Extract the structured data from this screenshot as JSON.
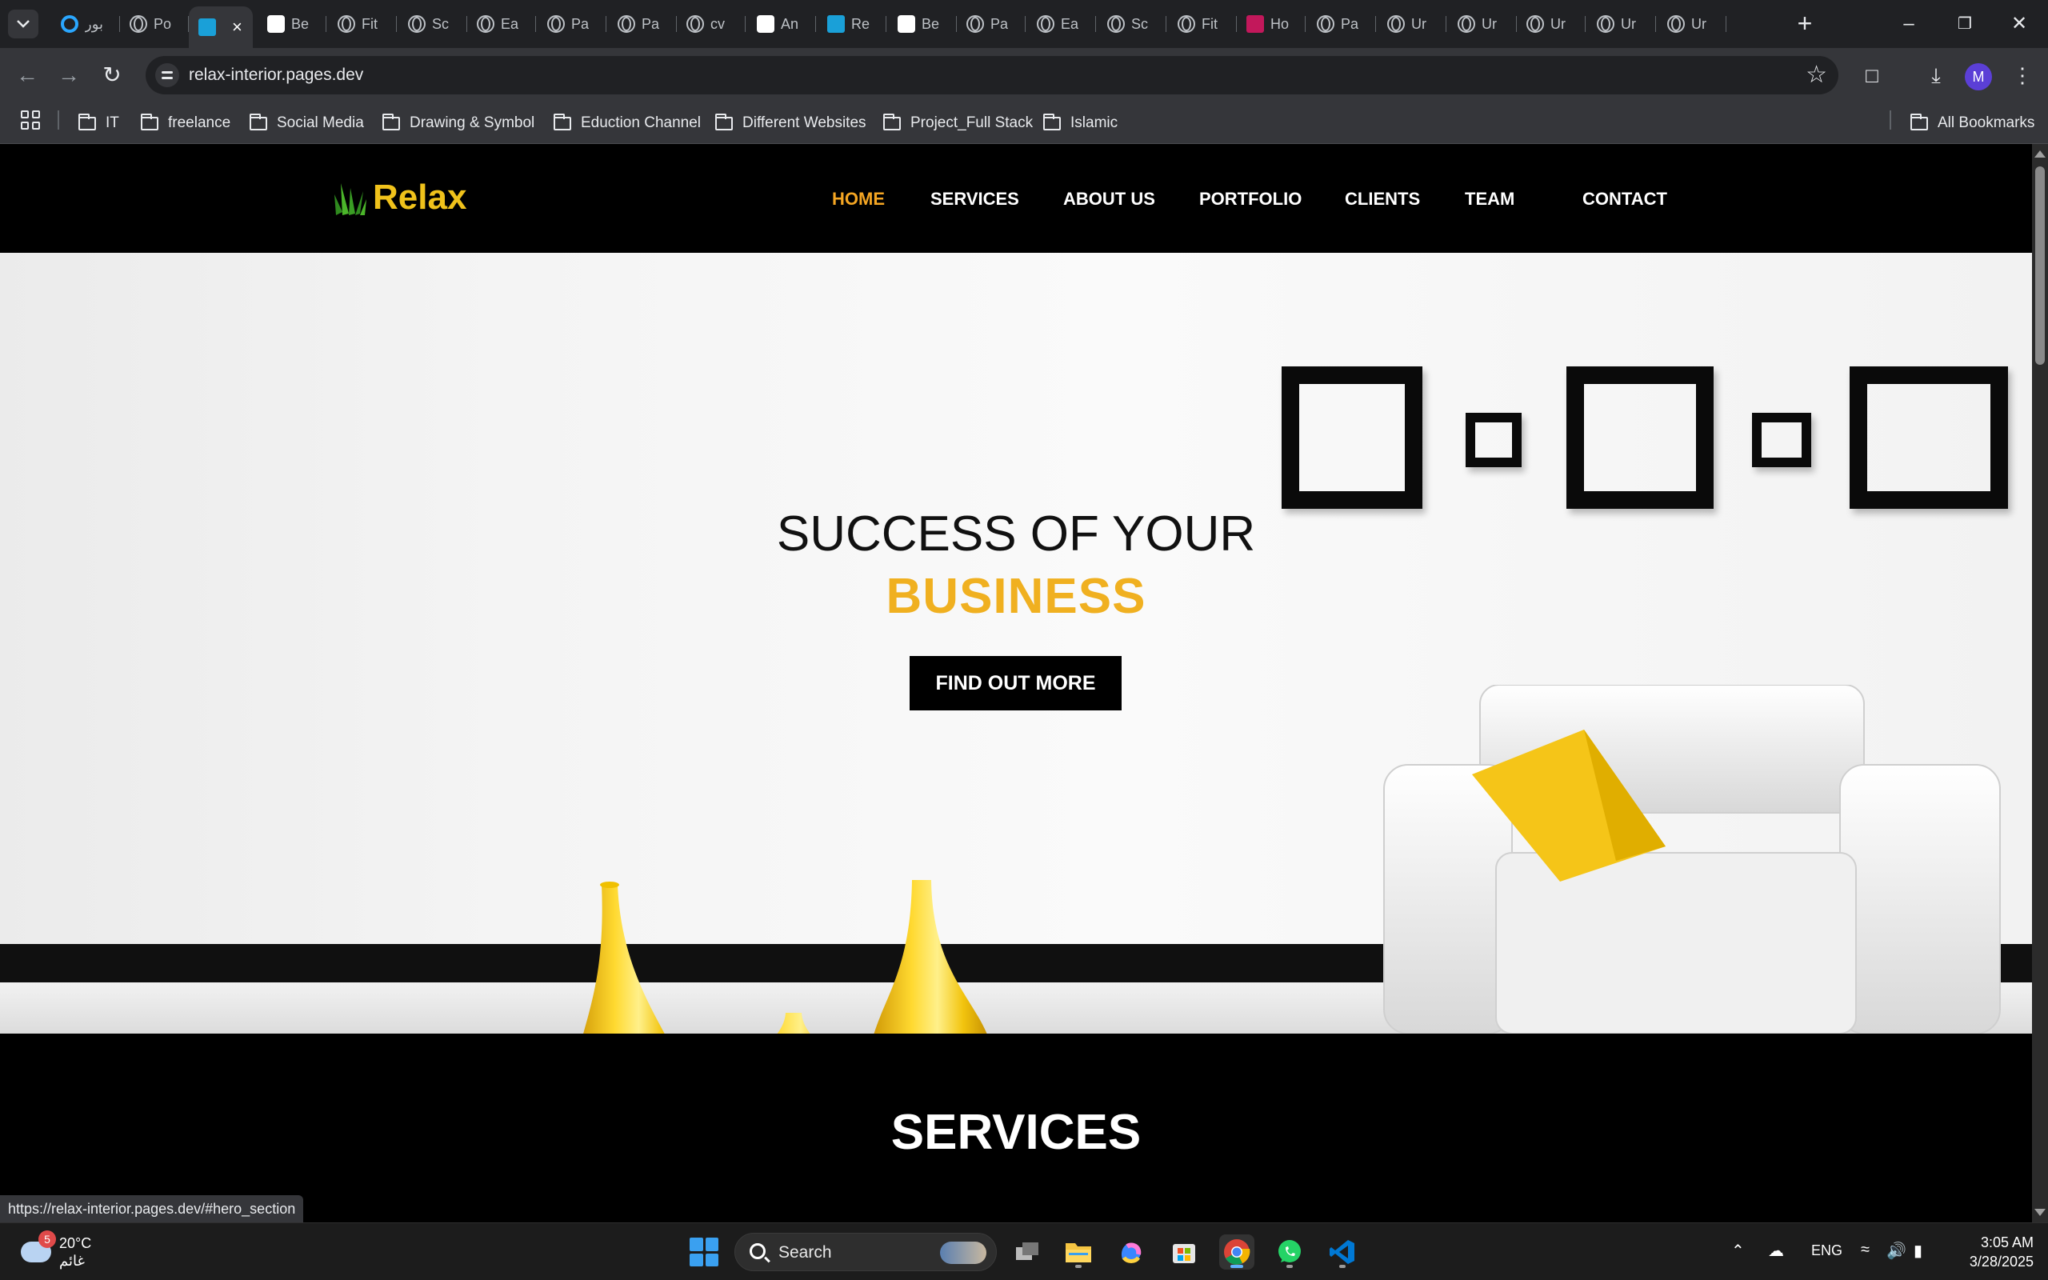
{
  "browser": {
    "tabs": [
      {
        "title": "بور",
        "icon": "cortana-icon",
        "active": false
      },
      {
        "title": "Po",
        "icon": "globe-icon",
        "active": false
      },
      {
        "title": "",
        "icon": "bing-icon",
        "active": true
      },
      {
        "title": "Be",
        "icon": "behance-icon",
        "active": false
      },
      {
        "title": "Fit",
        "icon": "globe-icon",
        "active": false
      },
      {
        "title": "Sc",
        "icon": "globe-icon",
        "active": false
      },
      {
        "title": "Ea",
        "icon": "globe-icon",
        "active": false
      },
      {
        "title": "Pa",
        "icon": "globe-icon",
        "active": false
      },
      {
        "title": "Pa",
        "icon": "globe-icon",
        "active": false
      },
      {
        "title": "cv",
        "icon": "globe-icon",
        "active": false
      },
      {
        "title": "An",
        "icon": "behance-icon",
        "active": false
      },
      {
        "title": "Re",
        "icon": "bing-icon",
        "active": false
      },
      {
        "title": "Be",
        "icon": "behance-icon",
        "active": false
      },
      {
        "title": "Pa",
        "icon": "globe-icon",
        "active": false
      },
      {
        "title": "Ea",
        "icon": "globe-icon",
        "active": false
      },
      {
        "title": "Sc",
        "icon": "globe-icon",
        "active": false
      },
      {
        "title": "Fit",
        "icon": "globe-icon",
        "active": false
      },
      {
        "title": "Ho",
        "icon": "angular-icon",
        "active": false
      },
      {
        "title": "Pa",
        "icon": "globe-icon",
        "active": false
      },
      {
        "title": "Ur",
        "icon": "globe-icon",
        "active": false
      },
      {
        "title": "Ur",
        "icon": "globe-icon",
        "active": false
      },
      {
        "title": "Ur",
        "icon": "globe-icon",
        "active": false
      },
      {
        "title": "Ur",
        "icon": "globe-icon",
        "active": false
      },
      {
        "title": "Ur",
        "icon": "globe-icon",
        "active": false
      }
    ],
    "url": "relax-interior.pages.dev",
    "profile_initial": "M",
    "bookmarks": [
      "IT",
      "freelance",
      "Social Media",
      "Drawing & Symbol",
      "Eduction Channel",
      "Different Websites",
      "Project_Full Stack",
      "Islamic"
    ],
    "all_bookmarks": "All Bookmarks",
    "status_url": "https://relax-interior.pages.dev/#hero_section"
  },
  "site": {
    "logo": "Relax",
    "nav": [
      "HOME",
      "SERVICES",
      "ABOUT US",
      "PORTFOLIO",
      "CLIENTS",
      "TEAM",
      "CONTACT"
    ],
    "hero": {
      "title_line1": "SUCCESS OF YOUR",
      "title_line2": "BUSINESS",
      "button": "FIND OUT MORE"
    },
    "services_title": "SERVICES"
  },
  "taskbar": {
    "weather_temp": "20°C",
    "weather_desc": "غائم",
    "weather_badge": "5",
    "search_label": "Search",
    "language": "ENG",
    "time": "3:05 AM",
    "date": "3/28/2025"
  },
  "colors": {
    "accent_yellow": "#f0b020",
    "nav_active": "#f5a623",
    "logo_yellow": "#f0c21b"
  }
}
